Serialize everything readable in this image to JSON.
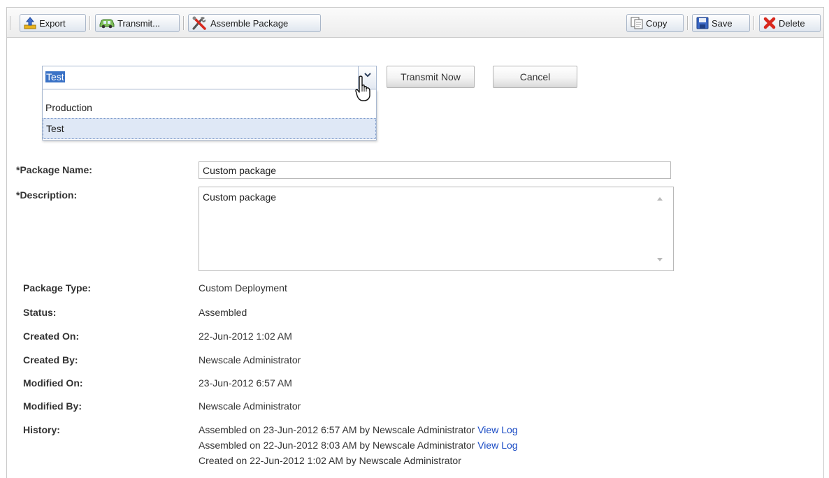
{
  "toolbar": {
    "export_label": "Export",
    "transmit_label": "Transmit...",
    "assemble_label": "Assemble Package",
    "copy_label": "Copy",
    "save_label": "Save",
    "delete_label": "Delete"
  },
  "transmit": {
    "selected_target": "Test",
    "options": [
      "Production",
      "Test"
    ],
    "transmit_now_label": "Transmit Now",
    "cancel_label": "Cancel"
  },
  "form": {
    "package_name_label": "*Package Name:",
    "package_name_value": "Custom package",
    "description_label": "*Description:",
    "description_value": "Custom package"
  },
  "details": {
    "package_type_label": "Package Type:",
    "package_type_value": "Custom Deployment",
    "status_label": "Status:",
    "status_value": "Assembled",
    "created_on_label": "Created On:",
    "created_on_value": "22-Jun-2012 1:02 AM",
    "created_by_label": "Created By:",
    "created_by_value": "Newscale Administrator",
    "modified_on_label": "Modified On:",
    "modified_on_value": "23-Jun-2012 6:57 AM",
    "modified_by_label": "Modified By:",
    "modified_by_value": "Newscale Administrator",
    "history_label": "History:"
  },
  "history": [
    {
      "text": "Assembled on 23-Jun-2012 6:57 AM by Newscale Administrator",
      "link": "View Log"
    },
    {
      "text": "Assembled on 22-Jun-2012 8:03 AM by Newscale Administrator",
      "link": "View Log"
    },
    {
      "text": "Created on 22-Jun-2012 1:02 AM by Newscale Administrator",
      "link": ""
    }
  ],
  "colors": {
    "accent_blue": "#3a72c6",
    "link_blue": "#1a4bc4",
    "delete_red": "#d8281e"
  }
}
